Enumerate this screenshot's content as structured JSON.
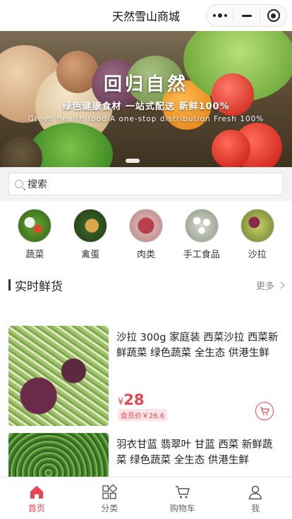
{
  "navbar": {
    "title": "天然雪山商城"
  },
  "banner": {
    "headline": "回归自然",
    "subtitle_cn": "绿色健康食材 一站式配送 新鲜100%",
    "subtitle_en": "Green health food  A one-stop distribution  Fresh 100%"
  },
  "search": {
    "placeholder": "搜索"
  },
  "categories": [
    {
      "label": "蔬菜"
    },
    {
      "label": "禽蛋"
    },
    {
      "label": "肉类"
    },
    {
      "label": "手工食品"
    },
    {
      "label": "沙拉"
    }
  ],
  "section": {
    "title": "实时鲜货",
    "more": "更多"
  },
  "products": [
    {
      "name": "沙拉 300g 家庭装 西菜沙拉 西菜新鲜蔬菜 绿色蔬菜 全生态 供港生鲜",
      "currency": "¥",
      "price": "28",
      "member_price": "会员价￥26.6"
    },
    {
      "name": "羽衣甘蓝 翡翠叶 甘蓝 西菜 新鲜蔬菜 绿色蔬菜 全生态 供港生鲜",
      "currency": "",
      "price": "",
      "member_price": ""
    }
  ],
  "tabbar": [
    {
      "label": "首页",
      "icon": "home-icon",
      "active": true
    },
    {
      "label": "分类",
      "icon": "category-icon",
      "active": false
    },
    {
      "label": "购物车",
      "icon": "cart-icon",
      "active": false
    },
    {
      "label": "我",
      "icon": "user-icon",
      "active": false
    }
  ],
  "colors": {
    "accent": "#e94550",
    "background": "#ffffff",
    "search_bg": "#f2f2f2"
  }
}
